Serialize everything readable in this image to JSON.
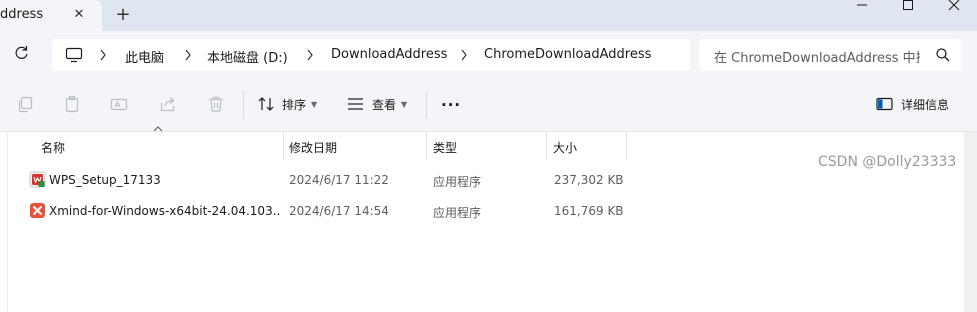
{
  "tab": {
    "title": "ddress",
    "close_icon": "close-icon",
    "new_tab_icon": "plus-icon"
  },
  "window_controls": [
    "minimize",
    "maximize",
    "close"
  ],
  "breadcrumb": {
    "items": [
      "此电脑",
      "本地磁盘 (D:)",
      "DownloadAddress",
      "ChromeDownloadAddress"
    ]
  },
  "search": {
    "placeholder": "在 ChromeDownloadAddress 中搜索"
  },
  "commandbar": {
    "sort_label": "排序",
    "view_label": "查看",
    "more_label": "···",
    "details_label": "详细信息",
    "icons": [
      "copy-icon",
      "paste-icon",
      "rename-icon",
      "share-icon",
      "delete-icon",
      "sort-icon",
      "view-icon",
      "details-pane-icon"
    ]
  },
  "columns": [
    "名称",
    "修改日期",
    "类型",
    "大小"
  ],
  "files": [
    {
      "name": "WPS_Setup_17133",
      "modified": "2024/6/17 11:22",
      "type": "应用程序",
      "size": "237,302 KB",
      "icon": "wps-installer-icon"
    },
    {
      "name": "Xmind-for-Windows-x64bit-24.04.103...",
      "modified": "2024/6/17 14:54",
      "type": "应用程序",
      "size": "161,769 KB",
      "icon": "xmind-icon"
    }
  ],
  "watermark": "CSDN @Dolly23333",
  "colors": {
    "chrome_bg": "#f3f5f9",
    "tab_strip_bg": "#dfe6f0",
    "accent": "#005fb8",
    "text": "#1a1a1a",
    "muted_text": "#5e5e5e"
  }
}
